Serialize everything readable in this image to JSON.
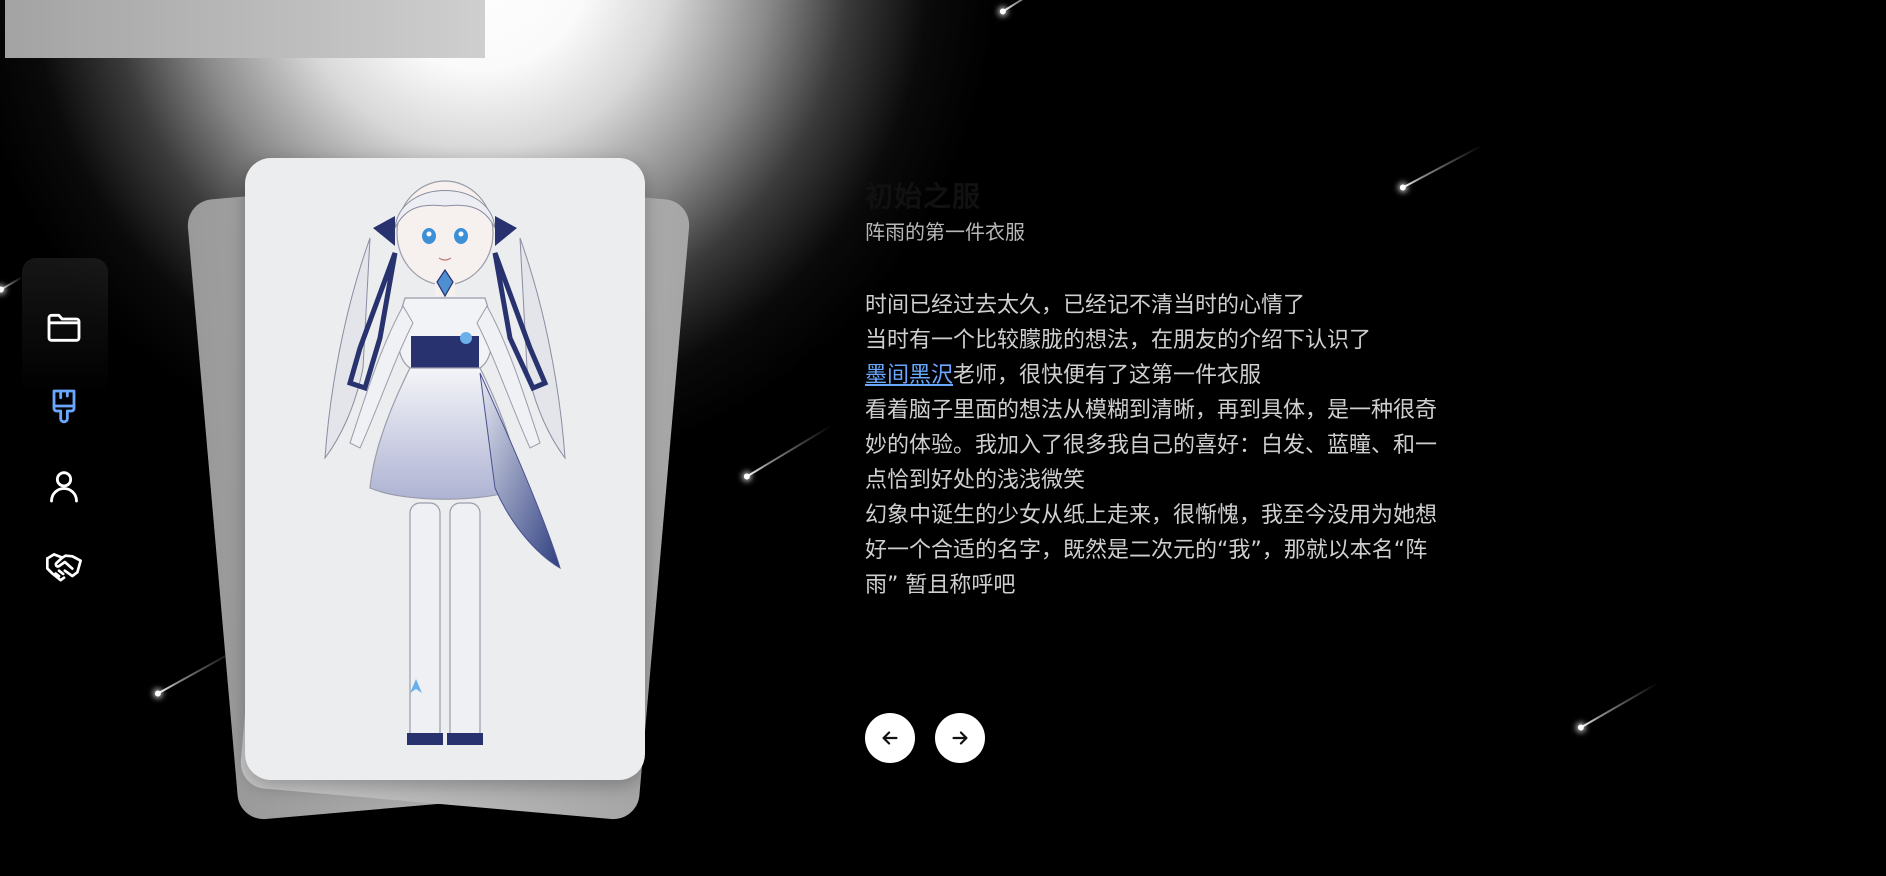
{
  "nav": {
    "items": [
      {
        "icon": "folder-icon",
        "active": false
      },
      {
        "icon": "paintbrush-icon",
        "active": true
      },
      {
        "icon": "user-icon",
        "active": false
      },
      {
        "icon": "handshake-icon",
        "active": false
      }
    ],
    "active_color": "#6aa8ff"
  },
  "card": {
    "image": "character-illustration"
  },
  "outfit": {
    "title": "初始之服",
    "subtitle": "阵雨的第一件衣服",
    "lines": {
      "l1": "时间已经过去太久，已经记不清当时的心情了",
      "l2": "当时有一个比较朦胧的想法，在朋友的介绍下认识了",
      "artist": "墨间黑沢",
      "l3_rest": "老师，很快便有了这第一件衣服",
      "l4": "看着脑子里面的想法从模糊到清晰，再到具体，是一种很奇妙的体验。我加入了很多我自己的喜好：白发、蓝瞳、和一点恰到好处的浅浅微笑",
      "l5": "幻象中诞生的少女从纸上走来，很惭愧，我至今没用为她想好一个合适的名字，既然是二次元的“我”，那就以本名“阵雨” 暂且称呼吧"
    }
  },
  "controls": {
    "prev_icon": "arrow-left-icon",
    "next_icon": "arrow-right-icon"
  }
}
